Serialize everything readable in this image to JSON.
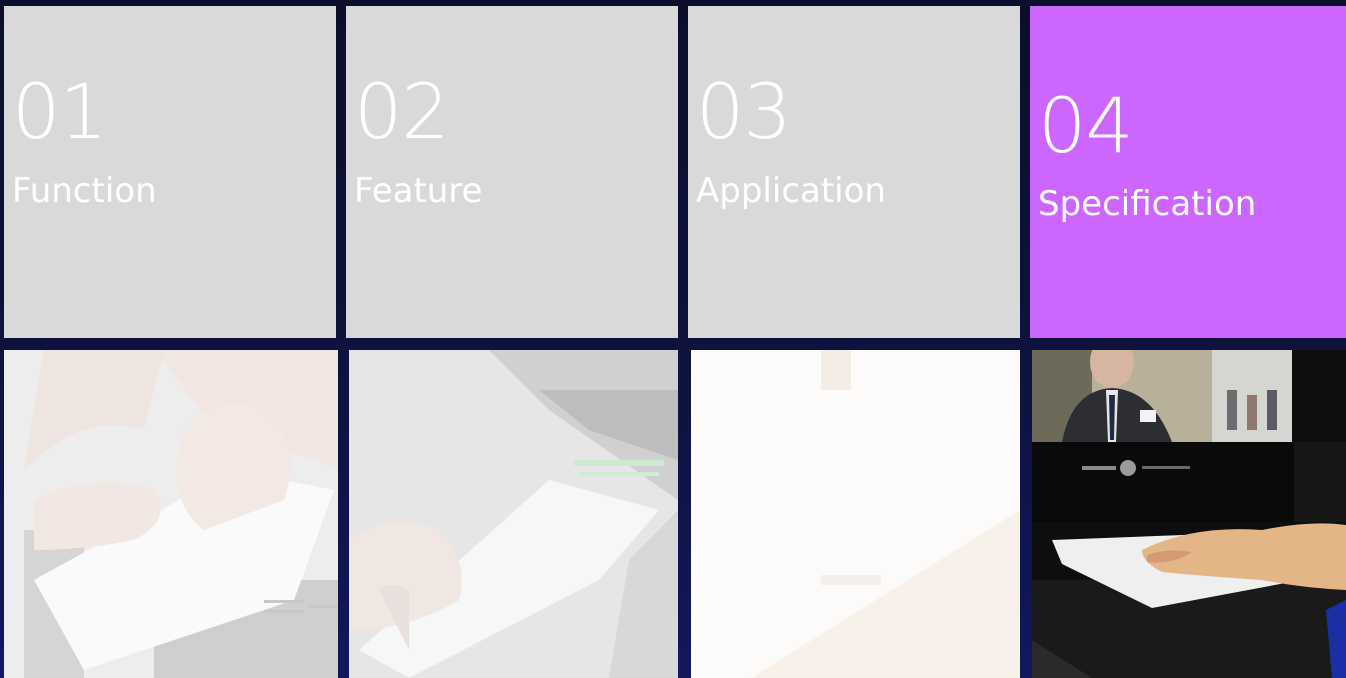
{
  "tiles": [
    {
      "number": "01",
      "label": "Function"
    },
    {
      "number": "02",
      "label": "Feature"
    },
    {
      "number": "03",
      "label": "Application"
    },
    {
      "number": "04",
      "label": "Specification"
    }
  ],
  "colors": {
    "tile_inactive": "#d9d9d9",
    "tile_active": "#cc66ff",
    "background": "#0b0f2c",
    "text": "#ffffff"
  },
  "photos": [
    {
      "icon": "hand-card-reader-photo"
    },
    {
      "icon": "card-insert-photo"
    },
    {
      "icon": "blank-document-photo"
    },
    {
      "icon": "video-terminal-card-photo"
    }
  ]
}
